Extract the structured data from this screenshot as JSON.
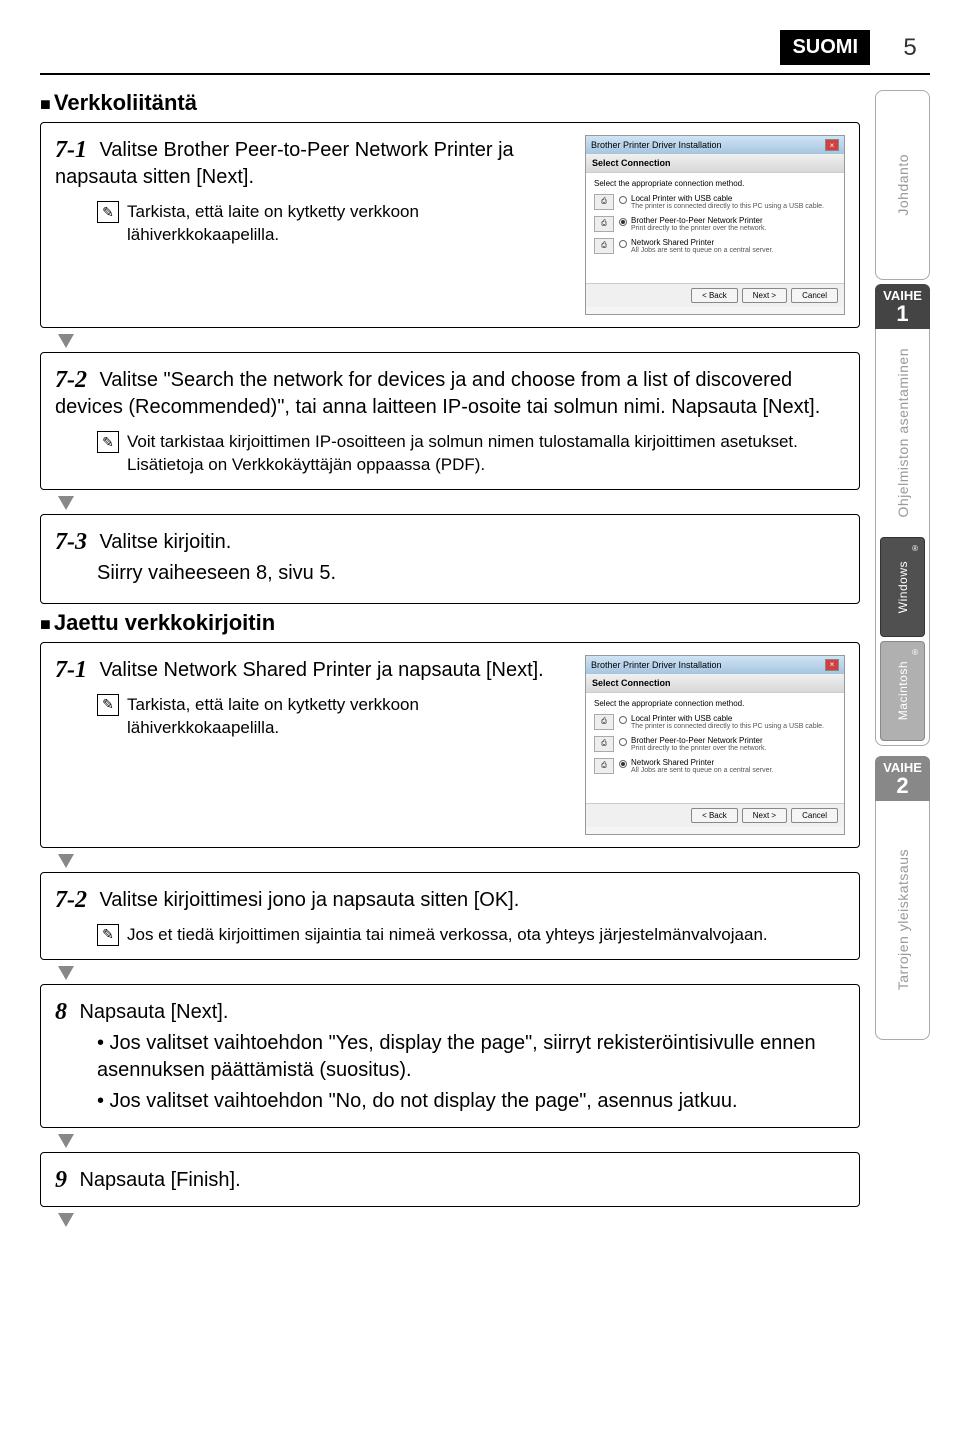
{
  "header": {
    "language": "SUOMI",
    "pageNumber": "5"
  },
  "sections": {
    "verkkoliitanta": {
      "title": "Verkkoliitäntä",
      "step7_1": {
        "label": "7-1",
        "text": "Valitse Brother Peer-to-Peer Network Printer ja napsauta sitten [Next].",
        "note": "Tarkista, että laite on kytketty verkkoon lähiverkkokaapelilla."
      },
      "step7_2": {
        "label": "7-2",
        "text": "Valitse \"Search the network for devices ja and choose from a list of discovered devices (Recommended)\", tai anna laitteen IP-osoite tai solmun nimi. Napsauta [Next].",
        "note": "Voit tarkistaa kirjoittimen IP-osoitteen ja solmun nimen tulostamalla kirjoittimen asetukset. Lisätietoja on Verkkokäyttäjän oppaassa (PDF)."
      },
      "step7_3": {
        "label": "7-3",
        "text": "Valitse kirjoitin.",
        "subtext": "Siirry vaiheeseen 8, sivu 5."
      }
    },
    "jaettu": {
      "title": "Jaettu verkkokirjoitin",
      "step7_1": {
        "label": "7-1",
        "text": "Valitse Network Shared Printer ja napsauta [Next].",
        "note": "Tarkista, että laite on kytketty verkkoon lähiverkkokaapelilla."
      },
      "step7_2": {
        "label": "7-2",
        "text": "Valitse kirjoittimesi jono ja napsauta sitten [OK].",
        "note": "Jos et tiedä kirjoittimen sijaintia tai nimeä verkossa, ota yhteys järjestelmänvalvojaan."
      }
    },
    "step8": {
      "label": "8",
      "text": "Napsauta [Next].",
      "bullet1": "• Jos valitset vaihtoehdon \"Yes, display the page\", siirryt rekisteröintisivulle ennen asennuksen päättämistä (suositus).",
      "bullet2": "• Jos valitset vaihtoehdon \"No, do not display the page\", asennus jatkuu."
    },
    "step9": {
      "label": "9",
      "text": "Napsauta [Finish]."
    }
  },
  "dialog1": {
    "title": "Brother Printer Driver Installation",
    "subtitle": "Select Connection",
    "prompt": "Select the appropriate connection method.",
    "opt1_title": "Local Printer with USB cable",
    "opt1_desc": "The printer is connected directly to this PC using a USB cable.",
    "opt2_title": "Brother Peer-to-Peer Network Printer",
    "opt2_desc": "Print directly to the printer over the network.",
    "opt3_title": "Network Shared Printer",
    "opt3_desc": "All Jobs are sent to queue on a central server.",
    "btn_back": "< Back",
    "btn_next": "Next >",
    "btn_cancel": "Cancel"
  },
  "dialog2": {
    "title": "Brother Printer Driver Installation",
    "subtitle": "Select Connection",
    "prompt": "Select the appropriate connection method.",
    "opt1_title": "Local Printer with USB cable",
    "opt1_desc": "The printer is connected directly to this PC using a USB cable.",
    "opt2_title": "Brother Peer-to-Peer Network Printer",
    "opt2_desc": "Print directly to the printer over the network.",
    "opt3_title": "Network Shared Printer",
    "opt3_desc": "All Jobs are sent to queue on a central server.",
    "btn_back": "< Back",
    "btn_next": "Next >",
    "btn_cancel": "Cancel"
  },
  "tabs": {
    "johdanto": "Johdanto",
    "vaihe": "VAIHE",
    "num1": "1",
    "num2": "2",
    "ohjelmiston": "Ohjelmiston asentaminen",
    "windows": "Windows",
    "macintosh": "Macintosh",
    "tarrojen": "Tarrojen yleiskatsaus"
  }
}
